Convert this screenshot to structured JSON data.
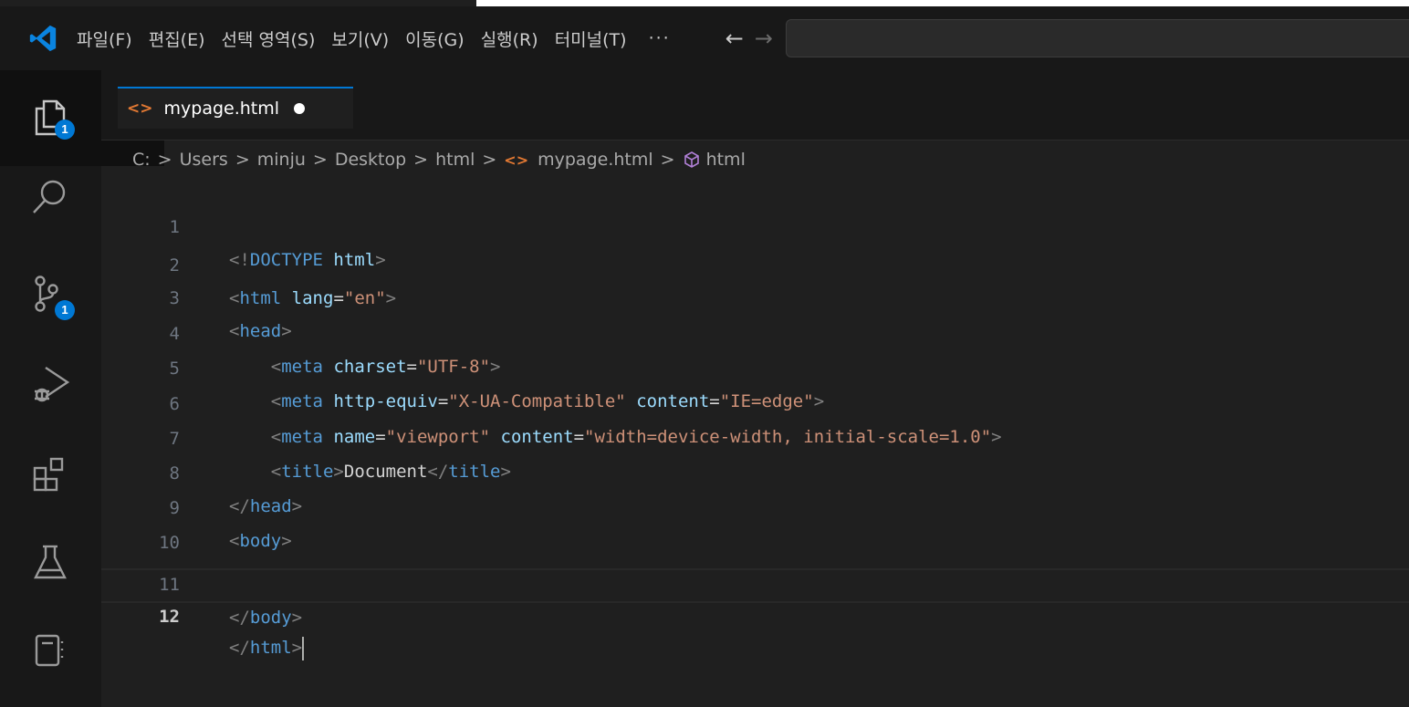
{
  "titlebar": {
    "menu": [
      "파일(F)",
      "편집(E)",
      "선택 영역(S)",
      "보기(V)",
      "이동(G)",
      "실행(R)",
      "터미널(T)"
    ],
    "more": "···",
    "back": "←",
    "forward": "→",
    "search_value": ""
  },
  "activitybar": {
    "items": [
      "explorer-icon",
      "search-icon",
      "source-control-icon",
      "run-debug-icon",
      "extensions-icon",
      "testing-icon",
      "notebook-icon"
    ],
    "explorer_badge": "1",
    "scm_badge": "1"
  },
  "tab": {
    "icon": "<>",
    "label": "mypage.html"
  },
  "breadcrumb": {
    "parts": [
      "C:",
      "Users",
      "minju",
      "Desktop",
      "html",
      "mypage.html",
      "html"
    ],
    "sep": ">"
  },
  "editor": {
    "line_numbers": [
      "1",
      "2",
      "3",
      "4",
      "5",
      "6",
      "7",
      "8",
      "9",
      "10",
      "11",
      "12"
    ],
    "active_line": 12,
    "lines": [
      "<!DOCTYPE html>",
      "<html lang=\"en\">",
      "<head>",
      "    <meta charset=\"UTF-8\">",
      "    <meta http-equiv=\"X-UA-Compatible\" content=\"IE=edge\">",
      "    <meta name=\"viewport\" content=\"width=device-width, initial-scale=1.0\">",
      "    <title>Document</title>",
      "</head>",
      "<body>",
      "",
      "</body>",
      "</html>"
    ]
  },
  "colors": {
    "accent": "#0078d4",
    "tag": "#569cd6",
    "attr": "#9cdcfe",
    "string": "#ce9178",
    "html_icon": "#e37933"
  }
}
